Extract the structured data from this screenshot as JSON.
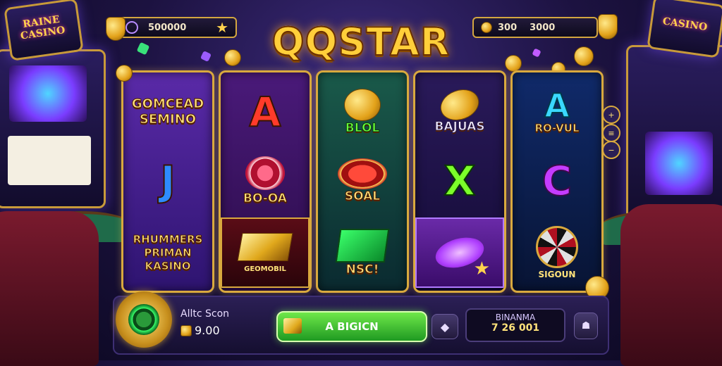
{
  "game": {
    "title": "QQSTAR",
    "colors": {
      "gold": "#ffcf3a",
      "panel": "#221a3a",
      "spin_green": "#2fb82a"
    }
  },
  "top_left_bar": {
    "icon": "chip-icon",
    "value": "500000",
    "suffix_icon": "star-icon"
  },
  "top_right_bar": {
    "icon": "coin-icon",
    "label": "300",
    "value": "3000"
  },
  "background_signs": {
    "left": "RAINE\nCASINO",
    "right": "CASINO"
  },
  "reels": [
    [
      {
        "type": "text",
        "text": "GOMCEAD\nSEMINO",
        "color": "#ffd84a"
      },
      {
        "type": "letter",
        "text": "J",
        "color": "#2e8bff"
      },
      {
        "type": "text",
        "text": "RHUMMERS\nPRIMAN\nKASINO",
        "color": "#ffd84a"
      }
    ],
    [
      {
        "type": "letter",
        "text": "A",
        "color": "#ff3b2a"
      },
      {
        "type": "symbol",
        "icon": "chip-icon",
        "label": "BO-OA"
      },
      {
        "type": "symbol",
        "icon": "gold-bar-icon",
        "label": "GEOMOBIL"
      }
    ],
    [
      {
        "type": "symbol",
        "icon": "coin-icon",
        "label": "BLOL"
      },
      {
        "type": "symbol",
        "icon": "chip-icon",
        "label": "SOAL"
      },
      {
        "type": "symbol",
        "icon": "cash-icon",
        "label": "NSC!"
      }
    ],
    [
      {
        "type": "symbol",
        "icon": "coin-icon",
        "label": "BAJUAS"
      },
      {
        "type": "letter",
        "text": "X",
        "color": "#7cff2a"
      },
      {
        "type": "symbol",
        "icon": "chip-icon",
        "label": ""
      }
    ],
    [
      {
        "type": "letter",
        "text": "A",
        "color": "#3ad8ff",
        "label": "RO-VUL"
      },
      {
        "type": "letter",
        "text": "C",
        "color": "#c43cff"
      },
      {
        "type": "symbol",
        "icon": "roulette-icon",
        "label": "SIGOUN"
      }
    ]
  ],
  "bottom": {
    "bet_label": "Alltc Scon",
    "bet_value": "9.00",
    "spin_label": "A BIGICN",
    "balance_label": "BINANMA",
    "balance_value": "7 26 001"
  },
  "side_buttons": [
    "+",
    "≡",
    "−"
  ]
}
